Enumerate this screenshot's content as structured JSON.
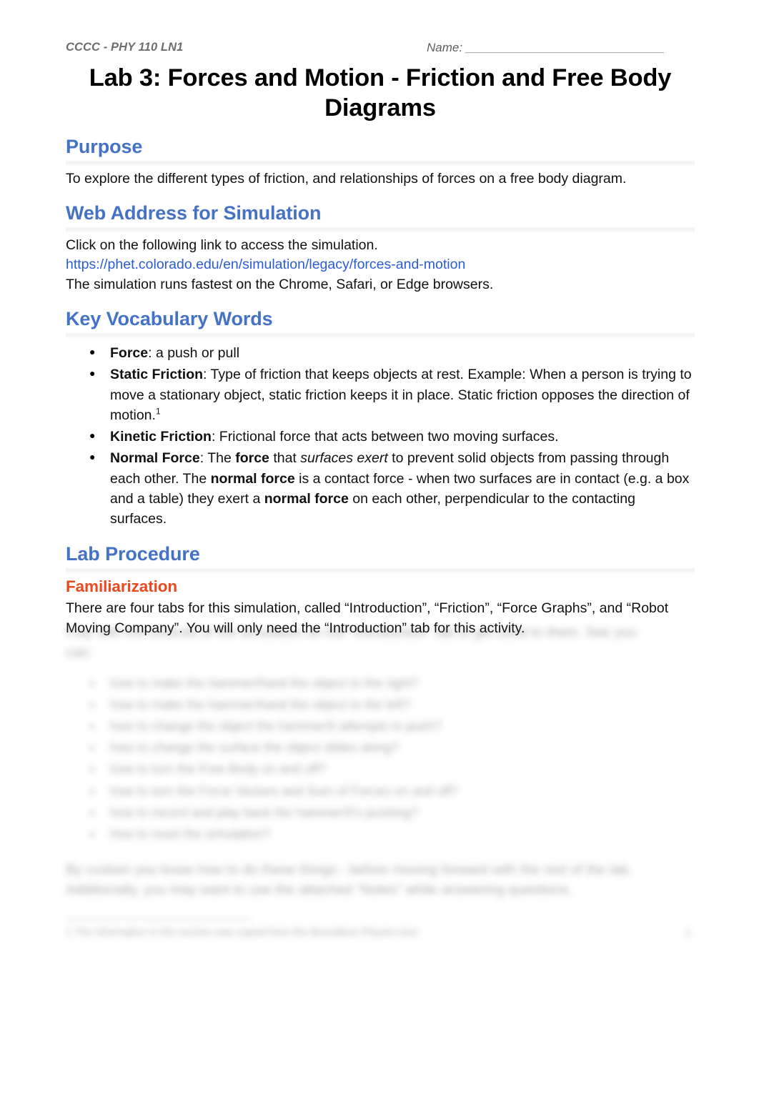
{
  "header": {
    "course": "CCCC - PHY 110 LN1",
    "name_label": "Name:",
    "name_rule": "_______________________________"
  },
  "title": "Lab 3: Forces and Motion - Friction and Free Body Diagrams",
  "sections": {
    "purpose": {
      "heading": "Purpose",
      "body": "To explore the different types of friction, and relationships of forces on a free body diagram."
    },
    "web_address": {
      "heading": "Web Address for Simulation",
      "intro": "Click on the following link to access the simulation.",
      "link_text": "https://phet.colorado.edu/en/simulation/legacy/forces-and-motion",
      "link_href": "https://phet.colorado.edu/en/simulation/legacy/forces-and-motion",
      "note": "The simulation runs fastest on the Chrome, Safari, or Edge browsers."
    },
    "vocabulary": {
      "heading": "Key Vocabulary Words",
      "items": [
        {
          "term": "Force",
          "sep": ": ",
          "definition": "a push or pull"
        },
        {
          "term": "Static Friction",
          "sep": ": ",
          "definition": "Type of friction that keeps objects at rest. Example: When a person is trying to move a stationary object, static friction keeps it in place. Static friction opposes the direction of motion.",
          "footnote_marker": "1"
        },
        {
          "term": "Kinetic Friction",
          "sep": ":  ",
          "definition": "Frictional force that acts between two moving surfaces."
        },
        {
          "term": "Normal Force",
          "sep": ": ",
          "definition_parts": [
            {
              "text": "The ",
              "style": "normal"
            },
            {
              "text": "force",
              "style": "bold"
            },
            {
              "text": " that ",
              "style": "normal"
            },
            {
              "text": "surfaces exert",
              "style": "italic"
            },
            {
              "text": " to prevent solid objects from passing through each other. The ",
              "style": "normal"
            },
            {
              "text": "normal force",
              "style": "bold"
            },
            {
              "text": " is a contact force - when two surfaces are in contact (e.g. a box and a table) they exert a ",
              "style": "normal"
            },
            {
              "text": "normal force",
              "style": "bold"
            },
            {
              "text": " on each other, perpendicular to the contacting surfaces.",
              "style": "normal"
            }
          ]
        }
      ]
    },
    "lab_procedure": {
      "heading": "Lab Procedure"
    },
    "familiarization": {
      "heading": "Familiarization",
      "body": "There are four tabs for this simulation, called “Introduction”, “Friction”, “Force Graphs”, and “Robot Moving Company”. You will only need the “Introduction” tab for this activity."
    },
    "redacted": {
      "note": "blurred-unreadable-content",
      "intro_line_1": "Play with the controls of the simulation on the “Introduction” tab to get used to them. See you",
      "intro_line_2": "can:",
      "items": [
        "how to make the hammer/hand the object to the right?",
        "how to make the hammer/hand the object to the left?",
        "how to change the object the hammer/it attempts to push?",
        "how to change the surface the object slides along?",
        "how to turn the Free Body on and off?",
        "how to turn the Force Vectors and Sum of Forces on and off?",
        "how to record and play back the hammer/it's pushing?",
        "how to reset the simulation?"
      ],
      "tail_line_1": "By custom you know how to do these things - before moving forward with the rest of the lab.",
      "tail_line_2": "Additionally, you may want to use the attached “Notes” while answering questions.",
      "footnote": "1 The information in this section was copied from the Boundless Physics text.",
      "page_number": "1"
    }
  }
}
